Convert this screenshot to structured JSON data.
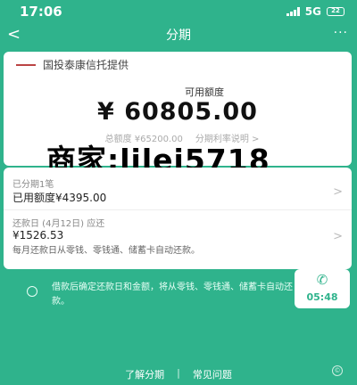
{
  "status_bar": {
    "time": "17:06",
    "network": "5G",
    "battery": "22"
  },
  "nav": {
    "back_icon": "back-icon",
    "title": "分期",
    "more_icon": "more-icon"
  },
  "card": {
    "provider": "国投泰康信托提供",
    "available_label": "可用额度",
    "available_amount": "¥ 60805.00",
    "total_label": "总额度 ¥65200.00",
    "rate_link": "分期利率说明 >"
  },
  "overlay_text": "商家:lilei5718",
  "installments": {
    "count_label": "已分期1笔",
    "used_label": "已用额度¥4395.00",
    "due_label": "还款日 (4月12日) 应还",
    "due_amount": "¥1526.53",
    "auto_note": "每月还款日从零钱、零钱通、储蓄卡自动还款。"
  },
  "notice": "借款后确定还款日和金额，将从零钱、零钱通、储蓄卡自动还款。",
  "floating_call": {
    "time": "05:48"
  },
  "footer": {
    "learn_link": "了解分期",
    "separator": "|",
    "faq_link": "常见问题"
  },
  "colors": {
    "brand_green": "#2fb38c"
  }
}
